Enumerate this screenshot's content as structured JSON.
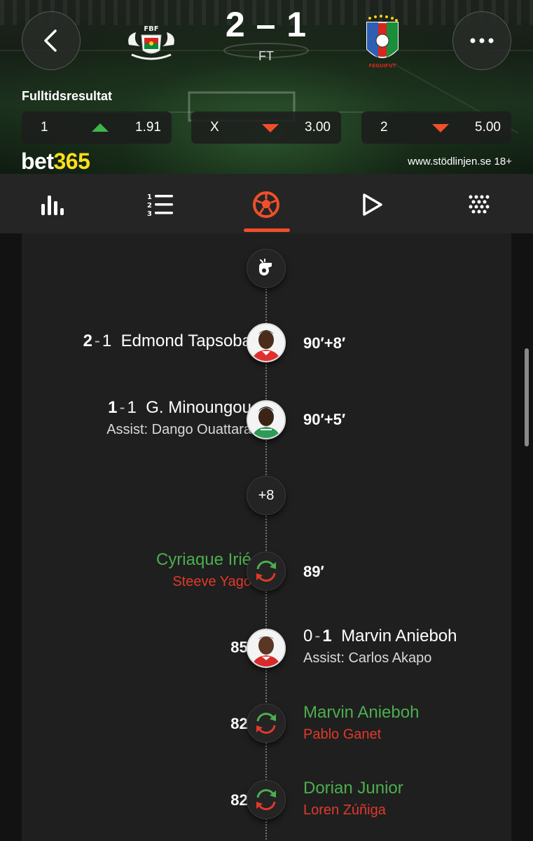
{
  "match": {
    "score": "2 – 1",
    "status": "FT",
    "home_crest_text": "FBF",
    "away_crest_text": "FEGUIFUT"
  },
  "market": {
    "title": "Fulltidsresultat",
    "odds": [
      {
        "selection": "1",
        "trend": "up",
        "price": "1.91"
      },
      {
        "selection": "X",
        "trend": "down",
        "price": "3.00"
      },
      {
        "selection": "2",
        "trend": "down",
        "price": "5.00"
      }
    ]
  },
  "brand": {
    "part1": "bet",
    "part2": "365",
    "helpline": "www.stödlinjen.se 18+"
  },
  "tabs": [
    "stats-icon",
    "lineups-icon",
    "events-icon",
    "video-icon",
    "more-icon"
  ],
  "colors": {
    "accent": "#f04f2a",
    "green": "#4cae4f",
    "red": "#e0392a",
    "brand_yellow": "#ffdf1b"
  },
  "events": [
    {
      "type": "goal",
      "side": "home",
      "score_home": "2",
      "score_away": "1",
      "player": "Edmond Tapsoba",
      "assist": "",
      "minute": "90′+8′"
    },
    {
      "type": "goal",
      "side": "home",
      "score_home": "1",
      "score_away": "1",
      "player": "G. Minoungou",
      "assist": "Assist: Dango Ouattara",
      "minute": "90′+5′"
    },
    {
      "type": "collapsed",
      "count": "+8"
    },
    {
      "type": "substitution",
      "side": "home",
      "player_in": "Cyriaque Irié",
      "player_out": "Steeve Yago",
      "minute": "89′"
    },
    {
      "type": "goal",
      "side": "away",
      "score_home": "0",
      "score_away": "1",
      "player": "Marvin Anieboh",
      "assist": "Assist: Carlos Akapo",
      "minute": "85′"
    },
    {
      "type": "substitution",
      "side": "away",
      "player_in": "Marvin Anieboh",
      "player_out": "Pablo Ganet",
      "minute": "82′"
    },
    {
      "type": "substitution",
      "side": "away",
      "player_in": "Dorian Junior",
      "player_out": "Loren Zúñiga",
      "minute": "82′"
    }
  ]
}
